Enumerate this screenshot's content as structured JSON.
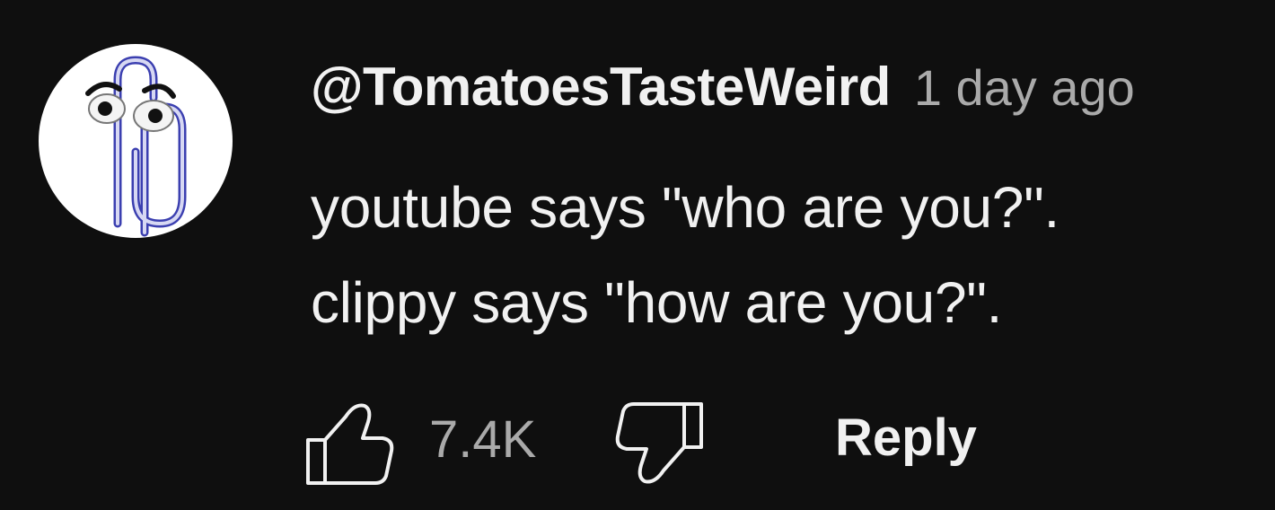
{
  "comment": {
    "author": "@TomatoesTasteWeird",
    "timestamp": "1 day ago",
    "text_lines": [
      "youtube says \"who are you?\".",
      "clippy says \"how are you?\"."
    ]
  },
  "avatar": {
    "icon": "clippy-paperclip-icon"
  },
  "actions": {
    "like_icon": "thumbs-up-icon",
    "like_count": "7.4K",
    "dislike_icon": "thumbs-down-icon",
    "reply_label": "Reply"
  },
  "colors": {
    "background": "#0f0f0f",
    "primary_text": "#f1f1f1",
    "secondary_text": "#aaaaaa"
  }
}
